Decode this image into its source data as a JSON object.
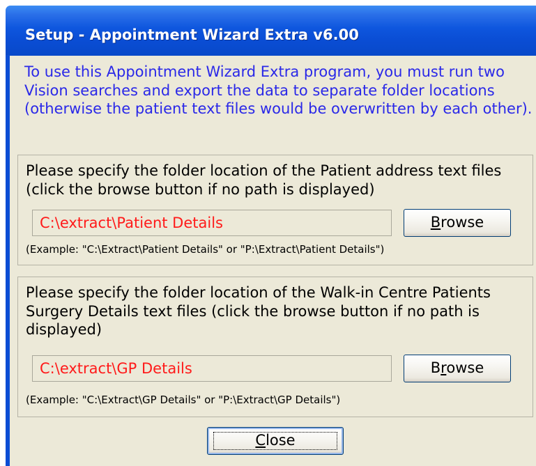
{
  "window": {
    "title": "Setup - Appointment Wizard Extra v6.00"
  },
  "intro_text": "To use this Appointment Wizard Extra program, you must run two Vision searches and export the data to separate folder locations (otherwise the patient text files would be overwritten by each other).",
  "patient_section": {
    "description": "Please specify the folder location of the Patient address text files (click the browse button if no path is displayed)",
    "path_value": "C:\\extract\\Patient Details",
    "browse_label_prefix": "",
    "browse_label_mnemonic": "B",
    "browse_label_rest": "rowse",
    "example": "(Example: \"C:\\Extract\\Patient Details\" or \"P:\\Extract\\Patient Details\")"
  },
  "gp_section": {
    "description": "Please specify the folder location of the Walk-in Centre Patients Surgery Details text files (click the browse button if no path is displayed)",
    "path_value": "C:\\extract\\GP Details",
    "browse_label_prefix": "B",
    "browse_label_mnemonic": "r",
    "browse_label_rest": "owse",
    "example": "(Example: \"C:\\Extract\\GP Details\" or \"P:\\Extract\\GP Details\")"
  },
  "close_button": {
    "label_mnemonic": "C",
    "label_rest": "lose"
  },
  "colors": {
    "title_bar": "#0a4dd4",
    "intro_text": "#2a28e8",
    "path_text": "#ff1a1a",
    "dialog_bg": "#ece9d8"
  }
}
